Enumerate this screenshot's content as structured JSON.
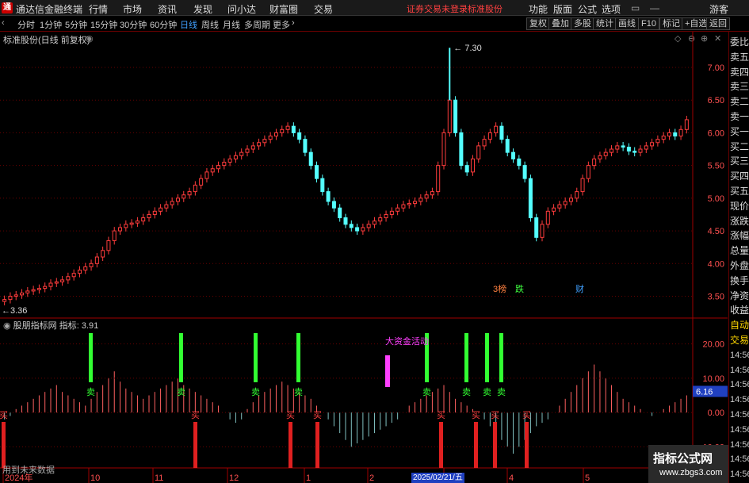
{
  "window": {
    "app_title": "通达信金融终端",
    "menus": [
      "行情",
      "市场",
      "资讯",
      "发现",
      "问小达",
      "财富圈",
      "交易"
    ],
    "status_text": "证券交易未登录",
    "stock_name": "标准股份",
    "right_menus": [
      "功能",
      "版面",
      "公式",
      "选项"
    ],
    "user": "游客"
  },
  "toolbar": {
    "periods": [
      "分时",
      "1分钟",
      "5分钟",
      "15分钟",
      "30分钟",
      "60分钟",
      "日线",
      "周线",
      "月线",
      "多周期",
      "更多"
    ],
    "active_period": "日线",
    "buttons": [
      "复权",
      "叠加",
      "多股",
      "统计",
      "画线",
      "F10",
      "标记",
      "+自选",
      "返回"
    ]
  },
  "chart": {
    "title": "标准股份(日线 前复权)",
    "high_label": "7.30",
    "low_label": "3.36",
    "event_markers": [
      "3榜",
      "跌",
      "财"
    ],
    "price_axis": [
      "7.00",
      "6.50",
      "6.00",
      "5.50",
      "5.00",
      "4.50",
      "4.00",
      "3.50"
    ],
    "date_axis": [
      "2024年",
      "10",
      "11",
      "12",
      "1",
      "2",
      "3",
      "4",
      "5"
    ],
    "selected_date": "2025/02/21/五"
  },
  "indicator": {
    "title": "股朋指标网",
    "label": "指标:",
    "value": "3.91",
    "axis": [
      "20.00",
      "10.00",
      "0.00",
      "-10.00"
    ],
    "current_badge": "6.16",
    "annotation": "大资金活动",
    "sell_label": "卖",
    "buy_label": "买",
    "bottom_note": "用到未来数据"
  },
  "right_panel": [
    "委比",
    "卖五",
    "卖四",
    "卖三",
    "卖二",
    "卖一",
    "买一",
    "买二",
    "买三",
    "买四",
    "买五",
    "现价",
    "涨跌",
    "涨幅",
    "总量",
    "外盘",
    "换手",
    "净资",
    "收益",
    "自动",
    "交易",
    "14:56",
    "14:56",
    "14:56",
    "14:56",
    "14:56",
    "14:56",
    "14:56",
    "14:56",
    "14:56"
  ],
  "watermark": {
    "line1": "指标公式网",
    "line2": "www.zbgs3.com"
  },
  "chart_data": {
    "type": "candlestick",
    "title": "标准股份(日线 前复权)",
    "y_range": [
      3.3,
      7.4
    ],
    "y_ticks": [
      3.5,
      4.0,
      4.5,
      5.0,
      5.5,
      6.0,
      6.5,
      7.0
    ],
    "x_ticks": [
      "2024年",
      "10",
      "11",
      "12",
      "1",
      "2",
      "3",
      "4",
      "5"
    ],
    "highest": 7.3,
    "lowest": 3.36,
    "closes": [
      3.45,
      3.5,
      3.52,
      3.55,
      3.58,
      3.6,
      3.62,
      3.65,
      3.7,
      3.72,
      3.75,
      3.8,
      3.85,
      3.9,
      3.95,
      4.0,
      4.1,
      4.2,
      4.35,
      4.5,
      4.55,
      4.6,
      4.62,
      4.65,
      4.7,
      4.75,
      4.8,
      4.85,
      4.9,
      4.95,
      5.0,
      5.05,
      5.1,
      5.2,
      5.3,
      5.4,
      5.45,
      5.5,
      5.55,
      5.6,
      5.65,
      5.7,
      5.75,
      5.8,
      5.85,
      5.9,
      5.95,
      6.0,
      6.05,
      6.1,
      6.0,
      5.9,
      5.7,
      5.5,
      5.3,
      5.1,
      4.95,
      4.85,
      4.7,
      4.6,
      4.55,
      4.5,
      4.55,
      4.6,
      4.65,
      4.7,
      4.75,
      4.8,
      4.85,
      4.9,
      4.92,
      4.95,
      5.0,
      5.05,
      5.1,
      5.5,
      6.0,
      6.5,
      6.0,
      5.5,
      5.4,
      5.6,
      5.8,
      5.9,
      6.0,
      6.1,
      5.9,
      5.7,
      5.6,
      5.5,
      5.3,
      4.7,
      4.4,
      4.6,
      4.8,
      4.85,
      4.9,
      4.95,
      5.0,
      5.1,
      5.3,
      5.5,
      5.6,
      5.65,
      5.7,
      5.75,
      5.8,
      5.78,
      5.72,
      5.7,
      5.75,
      5.8,
      5.85,
      5.9,
      5.95,
      6.0,
      5.95,
      6.05,
      6.2
    ],
    "indicator_values": [
      -2,
      -1,
      1,
      2,
      3,
      4,
      5,
      6,
      7,
      8,
      6,
      5,
      4,
      3,
      2,
      4,
      6,
      8,
      10,
      12,
      9,
      7,
      6,
      5,
      4,
      5,
      6,
      7,
      8,
      9,
      10,
      8,
      7,
      6,
      5,
      4,
      3,
      2,
      0,
      -2,
      -3,
      -2,
      1,
      3,
      5,
      6,
      7,
      8,
      9,
      8,
      7,
      6,
      5,
      4,
      2,
      0,
      -2,
      -4,
      -6,
      -8,
      -10,
      -9,
      -8,
      -7,
      -6,
      -5,
      -4,
      -3,
      -2,
      0,
      2,
      3,
      4,
      5,
      6,
      7,
      8,
      6,
      4,
      3,
      2,
      1,
      0,
      -2,
      -4,
      -6,
      -8,
      -10,
      -12,
      -10,
      -8,
      -6,
      -4,
      -3,
      -2,
      0,
      2,
      4,
      6,
      8,
      10,
      12,
      14,
      12,
      10,
      8,
      6,
      4,
      3,
      2,
      1,
      0,
      -1,
      0,
      1,
      2,
      3,
      4,
      5
    ]
  }
}
